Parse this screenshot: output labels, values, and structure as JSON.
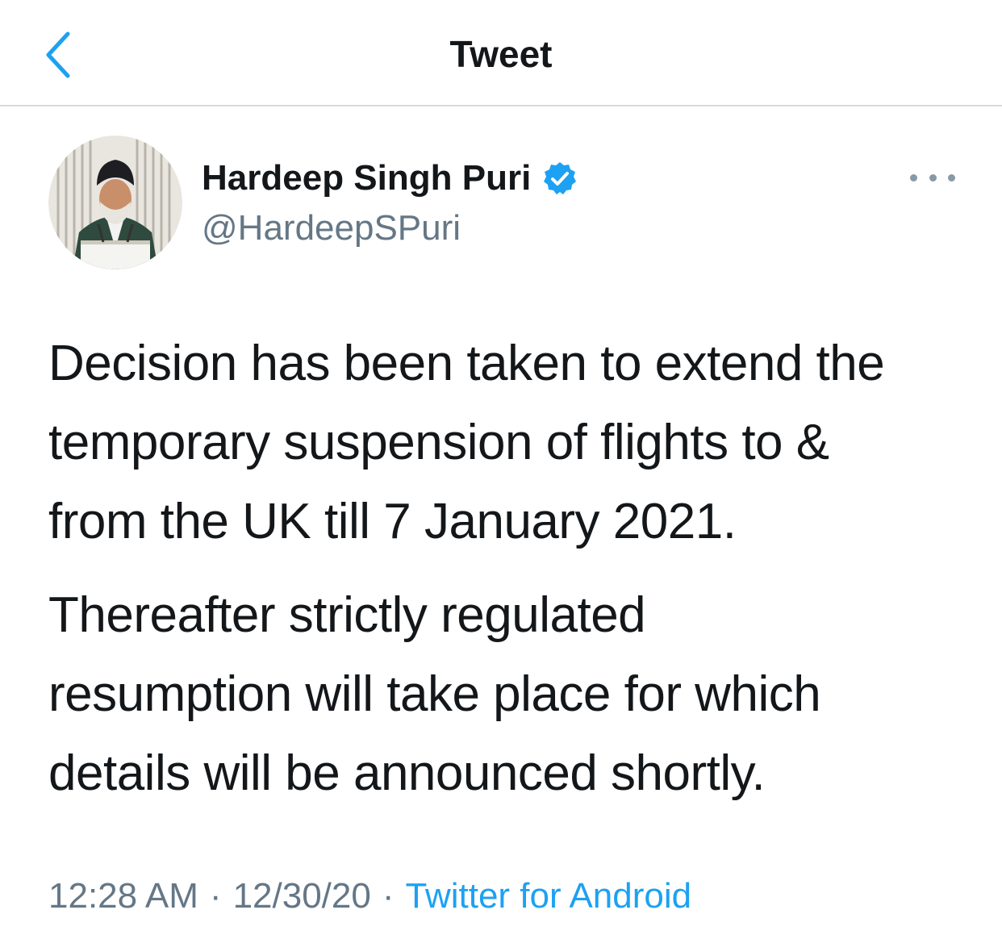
{
  "nav": {
    "title": "Tweet",
    "back_icon": "chevron-left-icon"
  },
  "author": {
    "name": "Hardeep Singh Puri",
    "handle": "@HardeepSPuri",
    "verified": true,
    "verified_icon": "verified-badge-icon"
  },
  "tweet": {
    "paragraphs": [
      "Decision has been taken to extend the\ntemporary suspension of flights to &\nfrom the UK till 7 January 2021.",
      "Thereafter strictly regulated\nresumption will take place for which\ndetails will be announced shortly."
    ],
    "time": "12:28 AM",
    "date": "12/30/20",
    "source": "Twitter for Android",
    "separator": "·"
  },
  "colors": {
    "accent": "#1da1f2",
    "text": "#14171a",
    "secondary": "#657786",
    "divider": "#d5d9dc"
  }
}
